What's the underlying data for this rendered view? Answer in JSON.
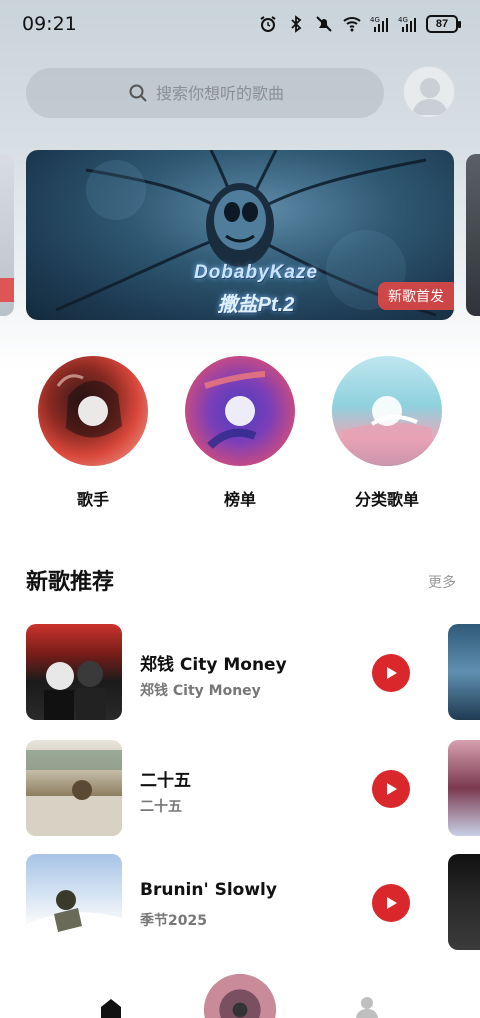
{
  "status_bar": {
    "time": "09:21",
    "battery": "87",
    "icons": [
      "alarm-icon",
      "bluetooth-icon",
      "mute-icon",
      "wifi-icon",
      "signal-4g-icon",
      "signal-4g-icon"
    ]
  },
  "search": {
    "placeholder": "搜索你想听的歌曲"
  },
  "banner": {
    "title": "DobabyKaze",
    "subtitle": "撒盐Pt.2",
    "tag": "新歌首发"
  },
  "categories": [
    {
      "label": "歌手",
      "icon": "singer-disc"
    },
    {
      "label": "榜单",
      "icon": "chart-disc"
    },
    {
      "label": "分类歌单",
      "icon": "category-disc"
    }
  ],
  "new_songs": {
    "title": "新歌推荐",
    "more": "更多",
    "items": [
      {
        "title": "郑钱 City Money",
        "artist": "郑钱 City Money"
      },
      {
        "title": "二十五",
        "artist": "二十五"
      },
      {
        "title": "Brunin' Slowly",
        "artist": "季节2025"
      }
    ]
  },
  "bottom_nav": {
    "items": [
      "home-icon",
      "now-playing-disc",
      "profile-icon"
    ]
  },
  "colors": {
    "accent": "#d9272b",
    "tag_bg": "#dc4646"
  }
}
